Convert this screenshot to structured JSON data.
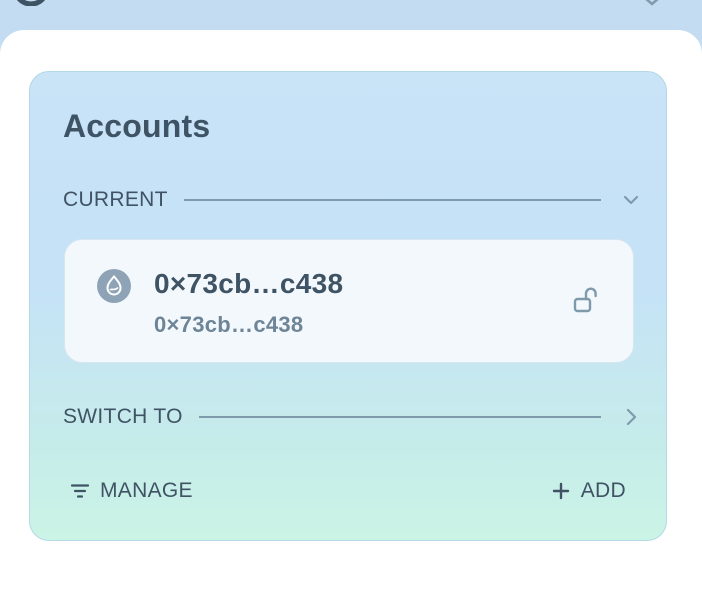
{
  "accounts_panel": {
    "title": "Accounts",
    "current_section_label": "CURRENT",
    "current_account": {
      "name": "0×73cb…c438",
      "address": "0×73cb…c438",
      "coin_icon": "sui-drop-icon",
      "lock_icon": "unlocked-padlock-icon"
    },
    "switch_section_label": "SWITCH TO",
    "manage_label": "MANAGE",
    "add_label": "ADD"
  },
  "colors": {
    "text_primary": "#3e5364",
    "text_secondary": "#6d8597",
    "card_gradient_top": "#c9e3f7",
    "card_gradient_bottom": "#cbf4e6",
    "account_card_bg": "#f3f8fd"
  }
}
